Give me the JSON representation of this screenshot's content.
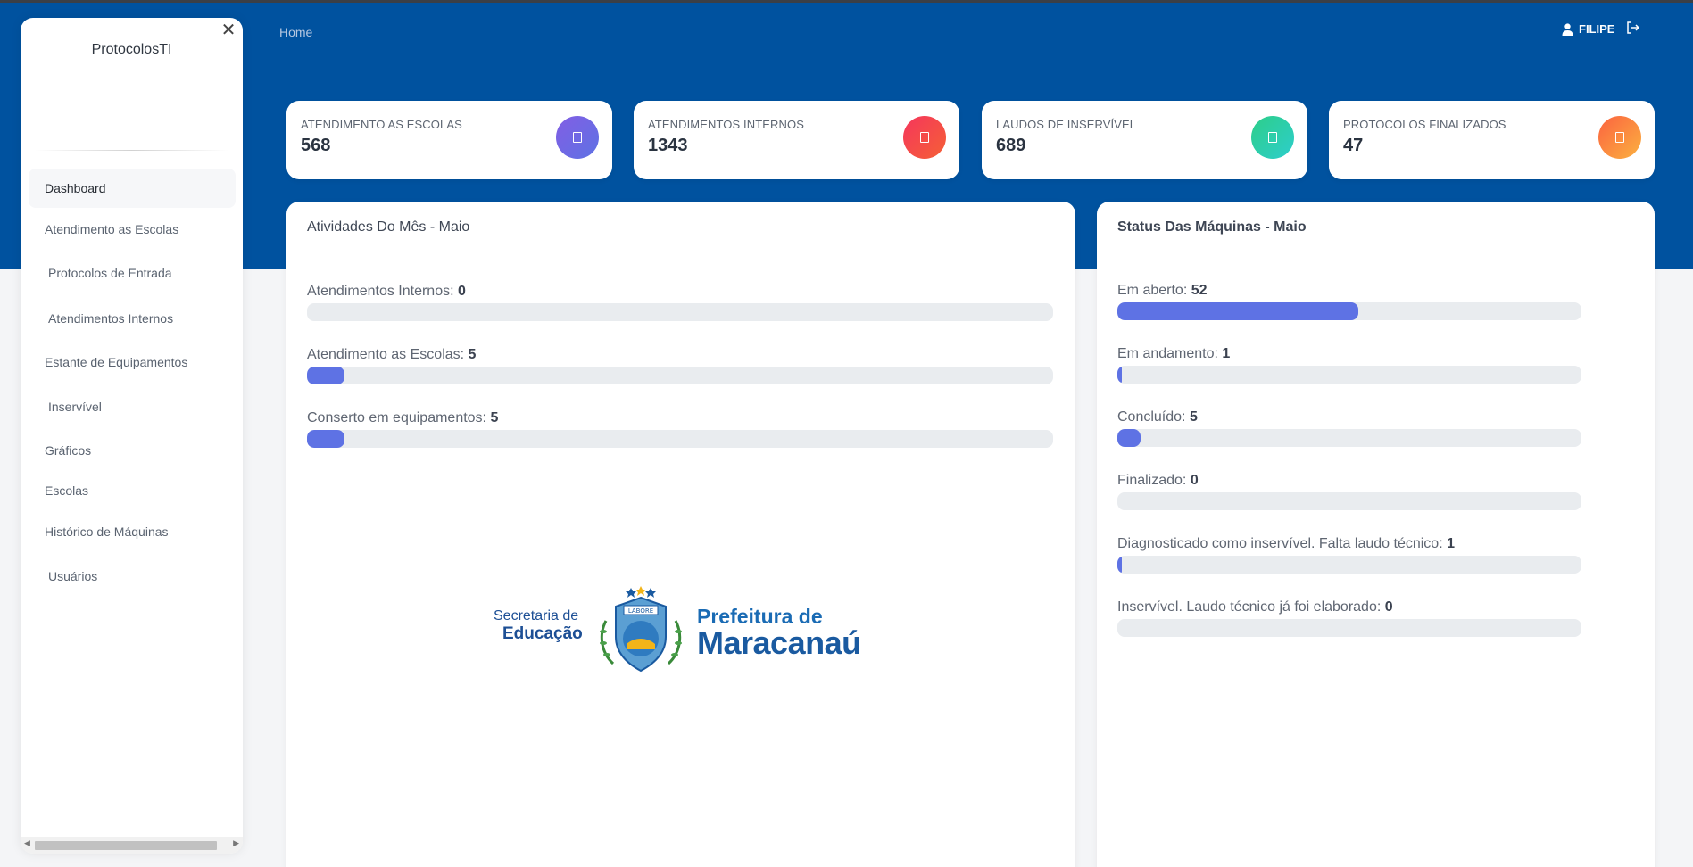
{
  "app": {
    "brand": "ProtocolosTI"
  },
  "sidebar": {
    "items": [
      {
        "label": "Dashboard",
        "active": true
      },
      {
        "label": "Atendimento as Escolas"
      },
      {
        "label": "Protocolos de Entrada"
      },
      {
        "label": "Atendimentos Internos"
      },
      {
        "label": "Estante de Equipamentos"
      },
      {
        "label": "Inservível"
      },
      {
        "label": "Gráficos"
      },
      {
        "label": "Escolas"
      },
      {
        "label": "Histórico de Máquinas"
      },
      {
        "label": "Usuários"
      }
    ]
  },
  "header": {
    "breadcrumb": "Home",
    "user": "FILIPE"
  },
  "stats": [
    {
      "title": "ATENDIMENTO AS ESCOLAS",
      "value": "568",
      "color": "#6f63e3"
    },
    {
      "title": "ATENDIMENTOS INTERNOS",
      "value": "1343",
      "color": "#f5365c"
    },
    {
      "title": "LAUDOS DE INSERVÍVEL",
      "value": "689",
      "color": "#2dce89"
    },
    {
      "title": "PROTOCOLOS FINALIZADOS",
      "value": "47",
      "color": "#fb6340"
    }
  ],
  "activities": {
    "title": "Atividades Do Mês - Maio",
    "items": [
      {
        "label": "Atendimentos Internos:",
        "value": "0",
        "fraction": 0.0
      },
      {
        "label": "Atendimento as Escolas:",
        "value": "5",
        "fraction": 0.05
      },
      {
        "label": "Conserto em equipamentos:",
        "value": "5",
        "fraction": 0.05
      }
    ]
  },
  "machines": {
    "title": "Status Das Máquinas - Maio",
    "items": [
      {
        "label": "Em aberto:",
        "value": "52",
        "fraction": 0.52
      },
      {
        "label": "Em andamento:",
        "value": "1",
        "fraction": 0.01
      },
      {
        "label": "Concluído:",
        "value": "5",
        "fraction": 0.05
      },
      {
        "label": "Finalizado:",
        "value": "0",
        "fraction": 0.0
      },
      {
        "label": "Diagnosticado como inservível. Falta laudo técnico:",
        "value": "1",
        "fraction": 0.01
      },
      {
        "label": "Inservível. Laudo técnico já foi elaborado:",
        "value": "0",
        "fraction": 0.0
      }
    ]
  },
  "logo": {
    "secretaria_line1": "Secretaria de",
    "secretaria_line2": "Educação",
    "seal_text": "LABORE",
    "prefeitura_line1": "Prefeitura de",
    "prefeitura_line2": "Maracanaú"
  },
  "icons": {
    "close": "close-icon",
    "user": "user-icon",
    "logout": "logout-icon",
    "card": "document-icon"
  }
}
